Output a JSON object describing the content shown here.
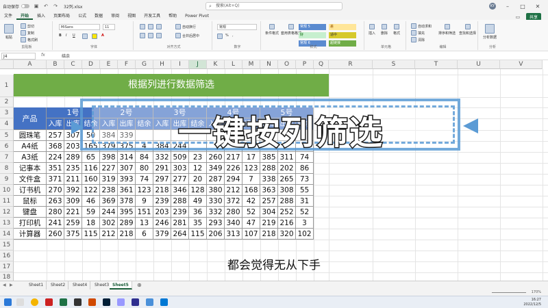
{
  "titlebar": {
    "autosave_label": "自动保存",
    "doc_title": "32列.xlsx",
    "search_placeholder": "搜索(Alt+Q)",
    "user_initials": "KY"
  },
  "ribbon_tabs": [
    "文件",
    "开始",
    "插入",
    "页面布局",
    "公式",
    "数据",
    "审阅",
    "视图",
    "开发工具",
    "帮助",
    "Power Pivot"
  ],
  "active_tab": "开始",
  "share_label": "共享",
  "ribbon": {
    "clipboard": {
      "paste": "粘贴",
      "cut": "剪切",
      "copy": "复制",
      "format_painter": "格式刷",
      "label": "剪贴板"
    },
    "font": {
      "name": "MiSans",
      "size": "11",
      "label": "字体"
    },
    "alignment": {
      "wrap": "自动换行",
      "merge": "合并后居中",
      "label": "对齐方式"
    },
    "number": {
      "format": "常规",
      "label": "数字"
    },
    "styles": {
      "conditional": "条件格式",
      "table": "套用表格格式",
      "label": "样式",
      "cells": [
        "常规 5",
        "差",
        "好",
        "适中",
        "常规 6",
        "超链接"
      ]
    },
    "cells": {
      "insert": "插入",
      "delete": "删除",
      "format": "格式",
      "label": "单元格"
    },
    "editing": {
      "sum": "自动求和",
      "fill": "填充",
      "clear": "清除",
      "sort": "排序和筛选",
      "find": "查找和选择",
      "label": "编辑"
    },
    "analysis": {
      "analyze": "分析数据",
      "label": "分析"
    }
  },
  "formula_bar": {
    "name_box": "J4",
    "fx": "fx",
    "content": "结余"
  },
  "columns": [
    "A",
    "B",
    "C",
    "D",
    "E",
    "F",
    "G",
    "H",
    "I",
    "J",
    "K",
    "L",
    "M",
    "N",
    "O",
    "P",
    "Q",
    "R",
    "S",
    "T",
    "U",
    "V"
  ],
  "rows": [
    "1",
    "2",
    "3",
    "4",
    "5",
    "6",
    "7",
    "8",
    "9",
    "10",
    "11",
    "12",
    "13",
    "14",
    "15",
    "16",
    "17",
    "18",
    "19"
  ],
  "sheet_title": "根据列进行数据筛选",
  "table": {
    "product_header": "产品",
    "groups": [
      "1号",
      "2号",
      "3号",
      "4号",
      "5号"
    ],
    "sub_headers": [
      "入库",
      "出库",
      "结余"
    ],
    "products": [
      "圆珠笔",
      "A4纸",
      "A3纸",
      "记事本",
      "文件盒",
      "订书机",
      "鼠标",
      "键盘",
      "打印机",
      "计算器"
    ],
    "values": [
      [
        "257",
        "307",
        "50",
        "384",
        "339",
        "",
        "",
        "",
        "",
        "",
        "",
        "",
        "",
        "",
        ""
      ],
      [
        "368",
        "203",
        "165",
        "379",
        "375",
        "4",
        "384",
        "244",
        "",
        "",
        "",
        "",
        "",
        "",
        ""
      ],
      [
        "224",
        "289",
        "65",
        "398",
        "314",
        "84",
        "332",
        "509",
        "23",
        "260",
        "217",
        "17",
        "385",
        "311",
        "74"
      ],
      [
        "351",
        "235",
        "116",
        "227",
        "307",
        "80",
        "291",
        "303",
        "12",
        "349",
        "226",
        "123",
        "288",
        "202",
        "86"
      ],
      [
        "371",
        "211",
        "160",
        "319",
        "393",
        "74",
        "297",
        "277",
        "20",
        "287",
        "294",
        "7",
        "338",
        "265",
        "73"
      ],
      [
        "270",
        "392",
        "122",
        "238",
        "361",
        "123",
        "218",
        "346",
        "128",
        "380",
        "212",
        "168",
        "363",
        "308",
        "55"
      ],
      [
        "263",
        "309",
        "46",
        "369",
        "378",
        "9",
        "239",
        "288",
        "49",
        "330",
        "372",
        "42",
        "257",
        "288",
        "31"
      ],
      [
        "280",
        "221",
        "59",
        "244",
        "395",
        "151",
        "203",
        "239",
        "36",
        "332",
        "280",
        "52",
        "304",
        "252",
        "52"
      ],
      [
        "241",
        "259",
        "18",
        "302",
        "289",
        "13",
        "246",
        "281",
        "35",
        "293",
        "340",
        "47",
        "219",
        "216",
        "3"
      ],
      [
        "260",
        "375",
        "115",
        "212",
        "218",
        "6",
        "379",
        "264",
        "115",
        "206",
        "313",
        "107",
        "218",
        "320",
        "102"
      ]
    ]
  },
  "overlay": {
    "title": "一键按列筛选",
    "subtitle": "都会觉得无从下手"
  },
  "sheet_tabs": [
    "Sheet1",
    "Sheet2",
    "Sheet4",
    "Sheet3",
    "Sheet5"
  ],
  "active_sheet": "Sheet5",
  "status": {
    "zoom": "170%"
  },
  "taskbar": {
    "time": "16:27",
    "date": "2022/12/5"
  },
  "colors": {
    "excel_green": "#185c37",
    "title_green": "#70ad47",
    "header_blue": "#4472c4",
    "overlay_blue": "#5b9bd5"
  }
}
